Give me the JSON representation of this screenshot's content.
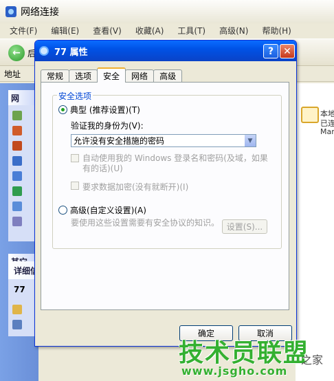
{
  "window": {
    "title": "网络连接"
  },
  "menu": [
    "文件(F)",
    "编辑(E)",
    "查看(V)",
    "收藏(A)",
    "工具(T)",
    "高级(N)",
    "帮助(H)"
  ],
  "toolbar": {
    "back_label": "后"
  },
  "address": {
    "label": "地址"
  },
  "taskpane": {
    "network_tasks_head": "网",
    "other_places_head": "其它",
    "details_head": "详细信息",
    "details_value": "77"
  },
  "rightpane": {
    "label1": "本地",
    "label2": "已连",
    "label3": "Mar"
  },
  "dialog": {
    "title": "77 属性",
    "tabs": [
      "常规",
      "选项",
      "安全",
      "网络",
      "高级"
    ],
    "active_tab": "安全",
    "group_label": "安全选项",
    "typical_label": "典型 (推荐设置)(T)",
    "verify_label": "验证我的身份为(V):",
    "verify_select": "允许没有安全措施的密码",
    "autologon_label": "自动使用我的 Windows 登录名和密码(及域，如果有的话)(U)",
    "encrypt_label": "要求数据加密(没有就断开)(I)",
    "advanced_label": "高级(自定义设置)(A)",
    "advanced_desc": "要使用这些设置需要有安全协议的知识。",
    "settings_button": "设置(S)...",
    "ok_button": "确定",
    "cancel_button": "取消"
  },
  "watermark": {
    "brand": "技术员联盟",
    "url": "www.jsgho.com",
    "side": "之家"
  }
}
